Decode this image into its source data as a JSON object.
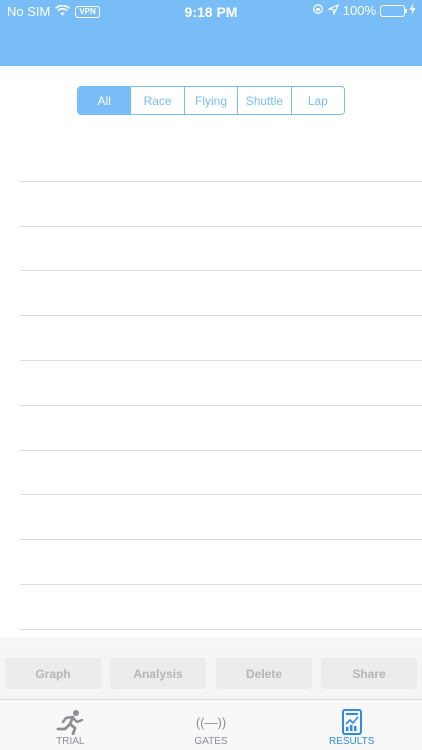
{
  "status_bar": {
    "carrier": "No SIM",
    "vpn_label": "VPN",
    "time": "9:18 PM",
    "battery_percent": "100%",
    "battery_level": 1.0
  },
  "segmented_control": {
    "segments": [
      "All",
      "Race",
      "Flying",
      "Shuttle",
      "Lap"
    ],
    "selected": "All"
  },
  "results_list": {
    "row_count": 11
  },
  "actions": {
    "graph": "Graph",
    "analysis": "Analysis",
    "delete": "Delete",
    "share": "Share"
  },
  "tabs": {
    "trial": "TRIAL",
    "gates": "GATES",
    "gates_glyph": "((—))",
    "results": "RESULTS",
    "active": "RESULTS"
  },
  "colors": {
    "header": "#78bdf6",
    "accent": "#2b8ce6",
    "battery": "#4cd964"
  }
}
